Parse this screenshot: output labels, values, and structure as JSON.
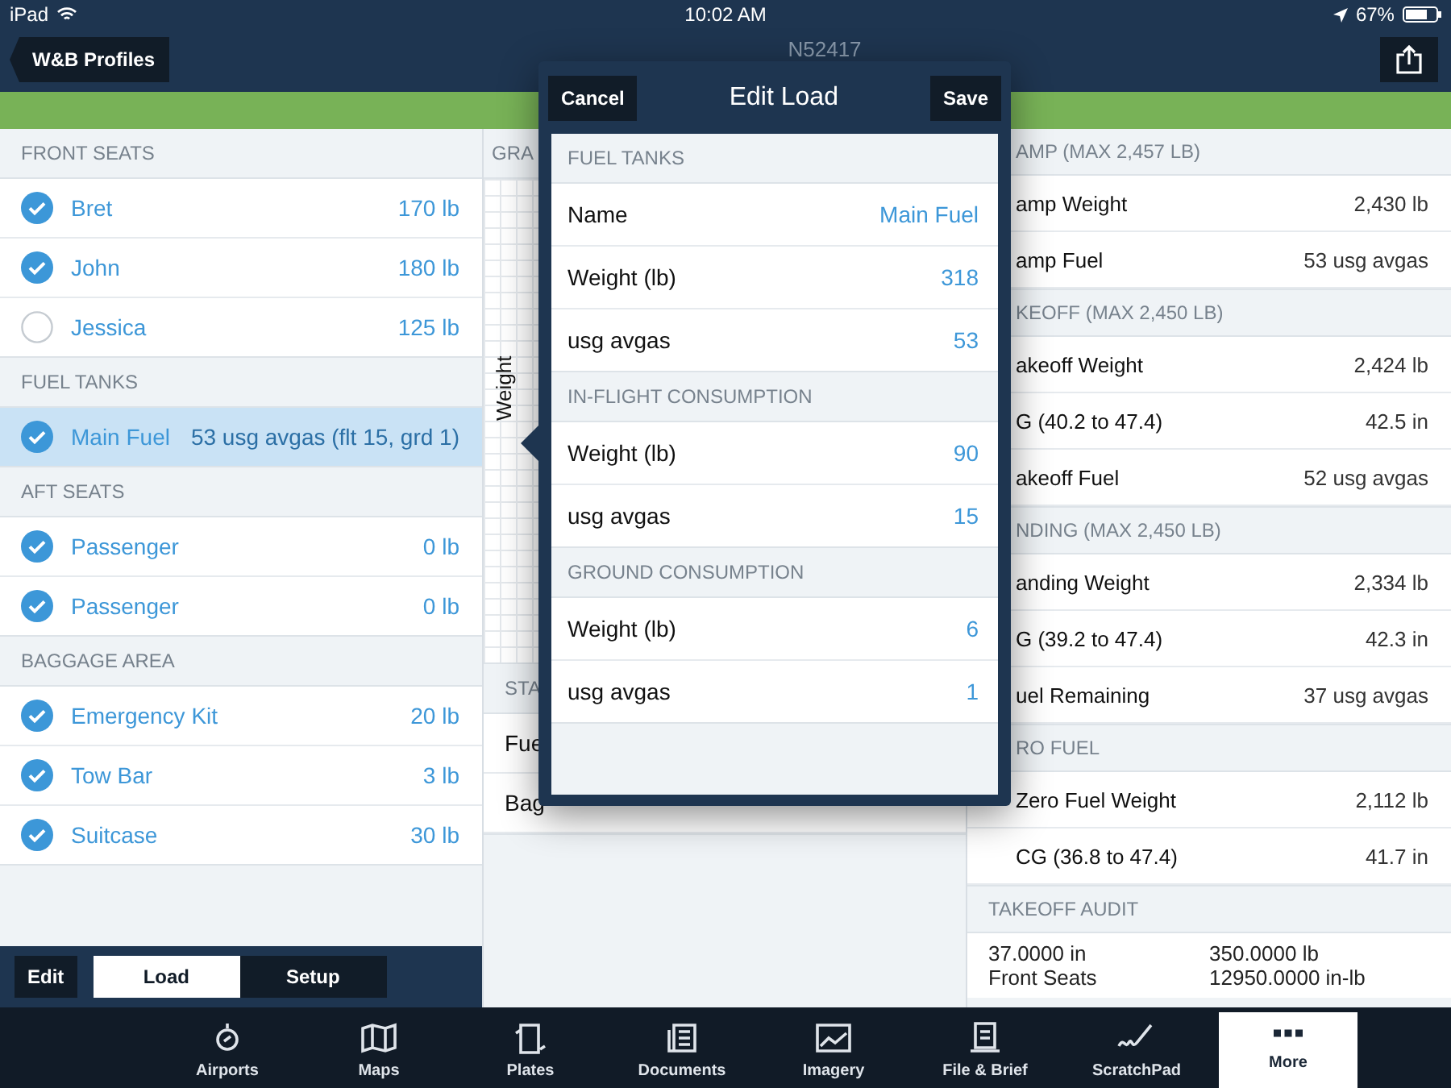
{
  "status_bar": {
    "device": "iPad",
    "time": "10:02 AM",
    "battery": "67%"
  },
  "nav": {
    "back": "W&B Profiles",
    "title": "N52417"
  },
  "load_list": {
    "sections": [
      {
        "title": "FRONT SEATS",
        "items": [
          {
            "name": "Bret",
            "value": "170 lb",
            "checked": true,
            "selected": false
          },
          {
            "name": "John",
            "value": "180 lb",
            "checked": true,
            "selected": false
          },
          {
            "name": "Jessica",
            "value": "125 lb",
            "checked": false,
            "selected": false
          }
        ]
      },
      {
        "title": "FUEL TANKS",
        "items": [
          {
            "name": "Main Fuel",
            "value": "53 usg avgas (flt 15, grd 1)",
            "checked": true,
            "selected": true
          }
        ]
      },
      {
        "title": "AFT SEATS",
        "items": [
          {
            "name": "Passenger",
            "value": "0 lb",
            "checked": true,
            "selected": false
          },
          {
            "name": "Passenger",
            "value": "0 lb",
            "checked": true,
            "selected": false
          }
        ]
      },
      {
        "title": "BAGGAGE AREA",
        "items": [
          {
            "name": "Emergency Kit",
            "value": "20 lb",
            "checked": true,
            "selected": false
          },
          {
            "name": "Tow Bar",
            "value": "3 lb",
            "checked": true,
            "selected": false
          },
          {
            "name": "Suitcase",
            "value": "30 lb",
            "checked": true,
            "selected": false
          }
        ]
      }
    ]
  },
  "toolbar": {
    "edit": "Edit",
    "segments": [
      {
        "label": "Load",
        "selected": true
      },
      {
        "label": "Setup",
        "selected": false
      }
    ]
  },
  "graph_panel": {
    "header": "GRA",
    "axis_label": "Weight",
    "station_header": "STA",
    "rows": [
      "Fue",
      "Bag"
    ]
  },
  "popover": {
    "cancel": "Cancel",
    "title": "Edit Load",
    "save": "Save",
    "sections": [
      {
        "title": "FUEL TANKS",
        "rows": [
          {
            "label": "Name",
            "value": "Main Fuel"
          },
          {
            "label": "Weight (lb)",
            "value": "318"
          },
          {
            "label": "usg avgas",
            "value": "53"
          }
        ]
      },
      {
        "title": "IN-FLIGHT CONSUMPTION",
        "rows": [
          {
            "label": "Weight (lb)",
            "value": "90"
          },
          {
            "label": "usg avgas",
            "value": "15"
          }
        ]
      },
      {
        "title": "GROUND CONSUMPTION",
        "rows": [
          {
            "label": "Weight (lb)",
            "value": "6"
          },
          {
            "label": "usg avgas",
            "value": "1"
          }
        ]
      }
    ]
  },
  "summary": {
    "sections": [
      {
        "title": "AMP (MAX 2,457 LB)",
        "rows": [
          {
            "label": "amp Weight",
            "value": "2,430 lb"
          },
          {
            "label": "amp Fuel",
            "value": "53 usg avgas"
          }
        ]
      },
      {
        "title": "KEOFF (MAX 2,450 LB)",
        "rows": [
          {
            "label": "akeoff Weight",
            "value": "2,424 lb"
          },
          {
            "label": "G (40.2 to 47.4)",
            "value": "42.5 in"
          },
          {
            "label": "akeoff Fuel",
            "value": "52 usg avgas"
          }
        ]
      },
      {
        "title": "NDING (MAX 2,450 LB)",
        "rows": [
          {
            "label": "anding Weight",
            "value": "2,334 lb"
          },
          {
            "label": "G (39.2 to 47.4)",
            "value": "42.3 in"
          },
          {
            "label": "uel Remaining",
            "value": "37 usg avgas"
          }
        ]
      },
      {
        "title": "RO FUEL",
        "rows": [
          {
            "label": "Zero Fuel Weight",
            "value": "2,112 lb"
          },
          {
            "label": "CG (36.8 to 47.4)",
            "value": "41.7 in"
          }
        ]
      }
    ],
    "audit": {
      "title": "TAKEOFF AUDIT",
      "rows": [
        [
          "37.0000 in",
          "350.0000 lb"
        ],
        [
          "Front Seats",
          "12950.0000 in-lb"
        ]
      ]
    }
  },
  "tab_bar": [
    {
      "label": "Airports",
      "selected": false
    },
    {
      "label": "Maps",
      "selected": false
    },
    {
      "label": "Plates",
      "selected": false
    },
    {
      "label": "Documents",
      "selected": false
    },
    {
      "label": "Imagery",
      "selected": false
    },
    {
      "label": "File & Brief",
      "selected": false
    },
    {
      "label": "ScratchPad",
      "selected": false
    },
    {
      "label": "More",
      "selected": true
    }
  ]
}
